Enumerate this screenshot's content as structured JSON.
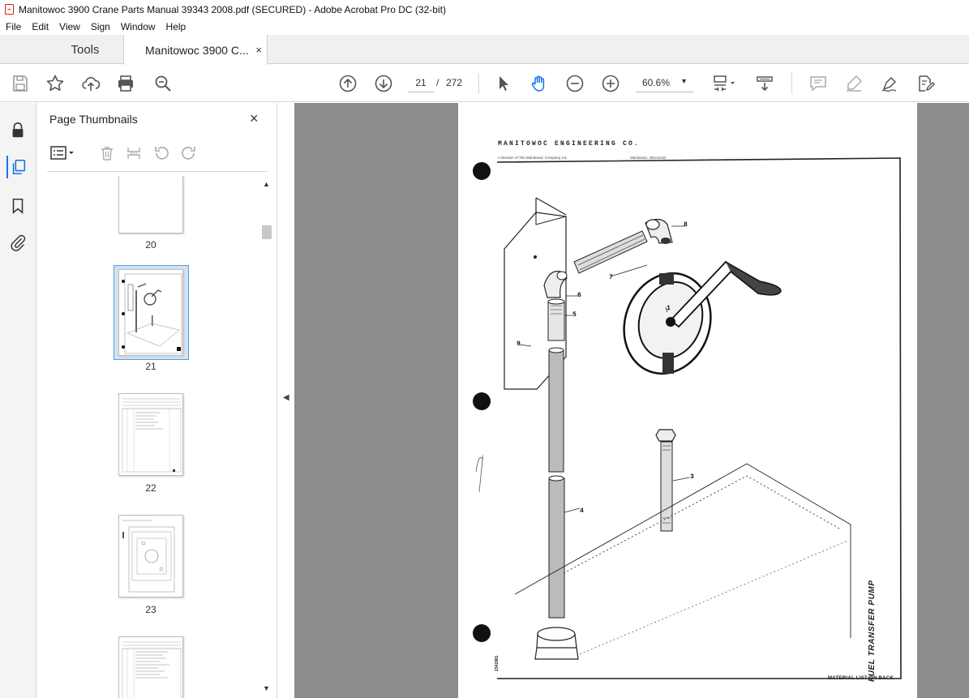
{
  "window": {
    "title": "Manitowoc 3900 Crane Parts Manual 39343 2008.pdf (SECURED) - Adobe Acrobat Pro DC (32-bit)"
  },
  "menu": [
    "File",
    "Edit",
    "View",
    "Sign",
    "Window",
    "Help"
  ],
  "tabs": {
    "tools_label": "Tools",
    "document_label": "Manitowoc 3900 C...",
    "close_symbol": "×"
  },
  "toolbar": {
    "current_page": "21",
    "page_separator": "/",
    "total_pages": "272",
    "zoom": "60.6%"
  },
  "thumbnail_panel": {
    "title": "Page Thumbnails",
    "close_symbol": "×",
    "pages": [
      "20",
      "21",
      "22",
      "23"
    ],
    "selected_page": "21"
  },
  "document_page": {
    "header": "MANITOWOC ENGINEERING CO.",
    "subheader_left": "A Division of The Manitowoc Company, Inc.",
    "subheader_right": "Manitowoc, Wisconsin",
    "side_title": "FUEL TRANSFER PUMP",
    "footer": "MATERIAL LIST ON BACK",
    "drawing_number": "2341981",
    "callouts": [
      "1",
      "3",
      "4",
      "5",
      "6",
      "7",
      "8",
      "9"
    ]
  },
  "colors": {
    "accent_blue": "#1473e6",
    "selection_bg": "#cfe3f6",
    "doc_background": "#8c8c8c"
  }
}
